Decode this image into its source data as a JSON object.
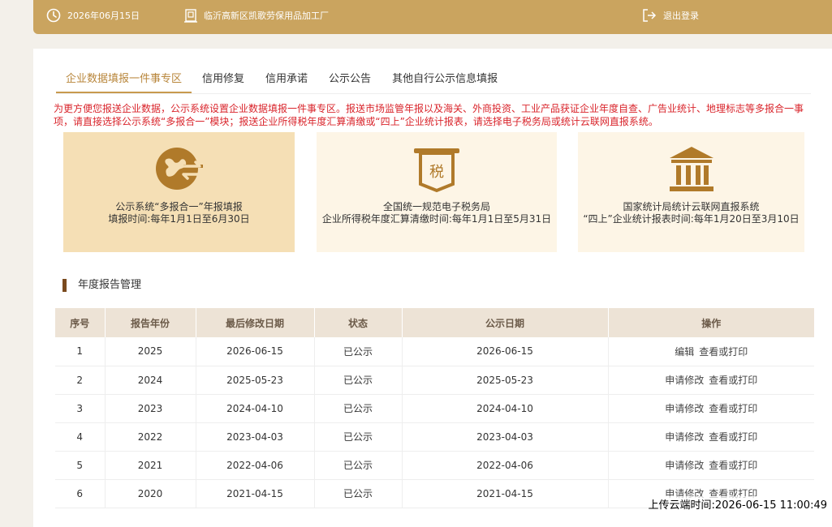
{
  "header": {
    "date": "2026年06月15日",
    "company": "临沂高新区凯歌劳保用品加工厂",
    "logout": "退出登录"
  },
  "tabs": [
    {
      "label": "企业数据填报一件事专区",
      "active": true
    },
    {
      "label": "信用修复"
    },
    {
      "label": "信用承诺"
    },
    {
      "label": "公示公告"
    },
    {
      "label": "其他自行公示信息填报"
    }
  ],
  "notice": "为更方便您报送企业数据，公示系统设置企业数据填报一件事专区。报送市场监管年报以及海关、外商投资、工业产品获证企业年度自查、广告业统计、地理标志等多报合一事项，请直接选择公示系统“多报合一”模块；报送企业所得税年度汇算清缴或“四上”企业统计报表，请选择电子税务局或统计云联网直报系统。",
  "cards": [
    {
      "line1": "公示系统“多报合一”年报填报",
      "line2": "填报时间:每年1月1日至6月30日",
      "icon": "report-combine-icon"
    },
    {
      "line1": "全国统一规范电子税务局",
      "line2": "企业所得税年度汇算清缴时间:每年1月1日至5月31日",
      "icon": "tax-icon",
      "badge": "税"
    },
    {
      "line1": "国家统计局统计云联网直报系统",
      "line2": "“四上”企业统计报表时间:每年1月20日至3月10日",
      "icon": "government-building-icon"
    }
  ],
  "section_title": "年度报告管理",
  "table": {
    "headers": [
      "序号",
      "报告年份",
      "最后修改日期",
      "状态",
      "公示日期",
      "操作"
    ],
    "rows": [
      {
        "no": "1",
        "year": "2025",
        "modified": "2026-06-15",
        "status": "已公示",
        "published": "2026-06-15",
        "op1": "编辑",
        "op2": "查看或打印"
      },
      {
        "no": "2",
        "year": "2024",
        "modified": "2025-05-23",
        "status": "已公示",
        "published": "2025-05-23",
        "op1": "申请修改",
        "op2": "查看或打印"
      },
      {
        "no": "3",
        "year": "2023",
        "modified": "2024-04-10",
        "status": "已公示",
        "published": "2024-04-10",
        "op1": "申请修改",
        "op2": "查看或打印"
      },
      {
        "no": "4",
        "year": "2022",
        "modified": "2023-04-03",
        "status": "已公示",
        "published": "2023-04-03",
        "op1": "申请修改",
        "op2": "查看或打印"
      },
      {
        "no": "5",
        "year": "2021",
        "modified": "2022-04-06",
        "status": "已公示",
        "published": "2022-04-06",
        "op1": "申请修改",
        "op2": "查看或打印"
      },
      {
        "no": "6",
        "year": "2020",
        "modified": "2021-04-15",
        "status": "已公示",
        "published": "2021-04-15",
        "op1": "申请修改",
        "op2": "查看或打印"
      }
    ]
  },
  "upload_time": "上传云端时间:2026-06-15 11:00:49",
  "colors": {
    "accent": "#caa45f",
    "notice": "#d9242b",
    "icon": "#b07a2a"
  }
}
